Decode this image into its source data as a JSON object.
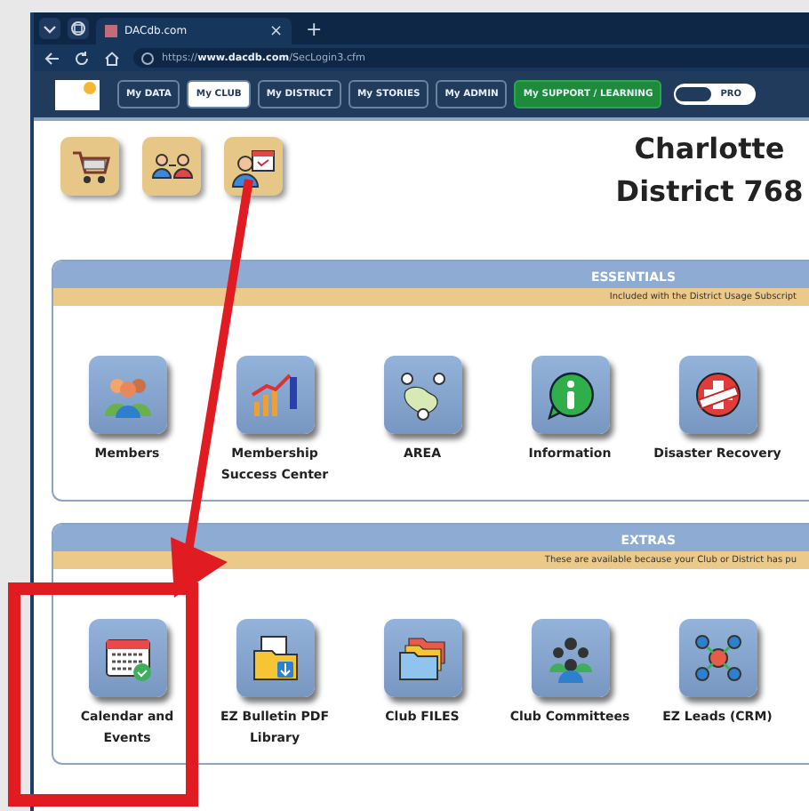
{
  "browser": {
    "tab_title": "DACdb.com",
    "close": "×",
    "new_tab": "+",
    "url_host": "www.dacdb.com",
    "url_prefix": "https://",
    "url_path": "/SecLogin3.cfm"
  },
  "nav": {
    "items": [
      {
        "label": "My DATA",
        "selected": false,
        "kind": "plain"
      },
      {
        "label": "My CLUB",
        "selected": true,
        "kind": "plain"
      },
      {
        "label": "My DISTRICT",
        "selected": false,
        "kind": "plain"
      },
      {
        "label": "My STORIES",
        "selected": false,
        "kind": "plain"
      },
      {
        "label": "My ADMIN",
        "selected": false,
        "kind": "plain"
      },
      {
        "label": "My SUPPORT / LEARNING",
        "selected": false,
        "kind": "green"
      }
    ],
    "toggle": {
      "label": "PRO"
    }
  },
  "heading": [
    "Charlotte",
    "District 768"
  ],
  "sections": [
    {
      "title": "ESSENTIALS",
      "subtitle": "Included with the District Usage Subscript",
      "items": [
        {
          "label": "Members"
        },
        {
          "label": "Membership Success Center"
        },
        {
          "label": "AREA"
        },
        {
          "label": "Information"
        },
        {
          "label": "Disaster Recovery"
        }
      ]
    },
    {
      "title": "EXTRAS",
      "subtitle": "These are available because your Club or District has pu",
      "items": [
        {
          "label": "Calendar and Events"
        },
        {
          "label": "EZ Bulletin PDF Library"
        },
        {
          "label": "Club FILES"
        },
        {
          "label": "Club Committees"
        },
        {
          "label": "EZ Leads (CRM)"
        }
      ]
    }
  ]
}
